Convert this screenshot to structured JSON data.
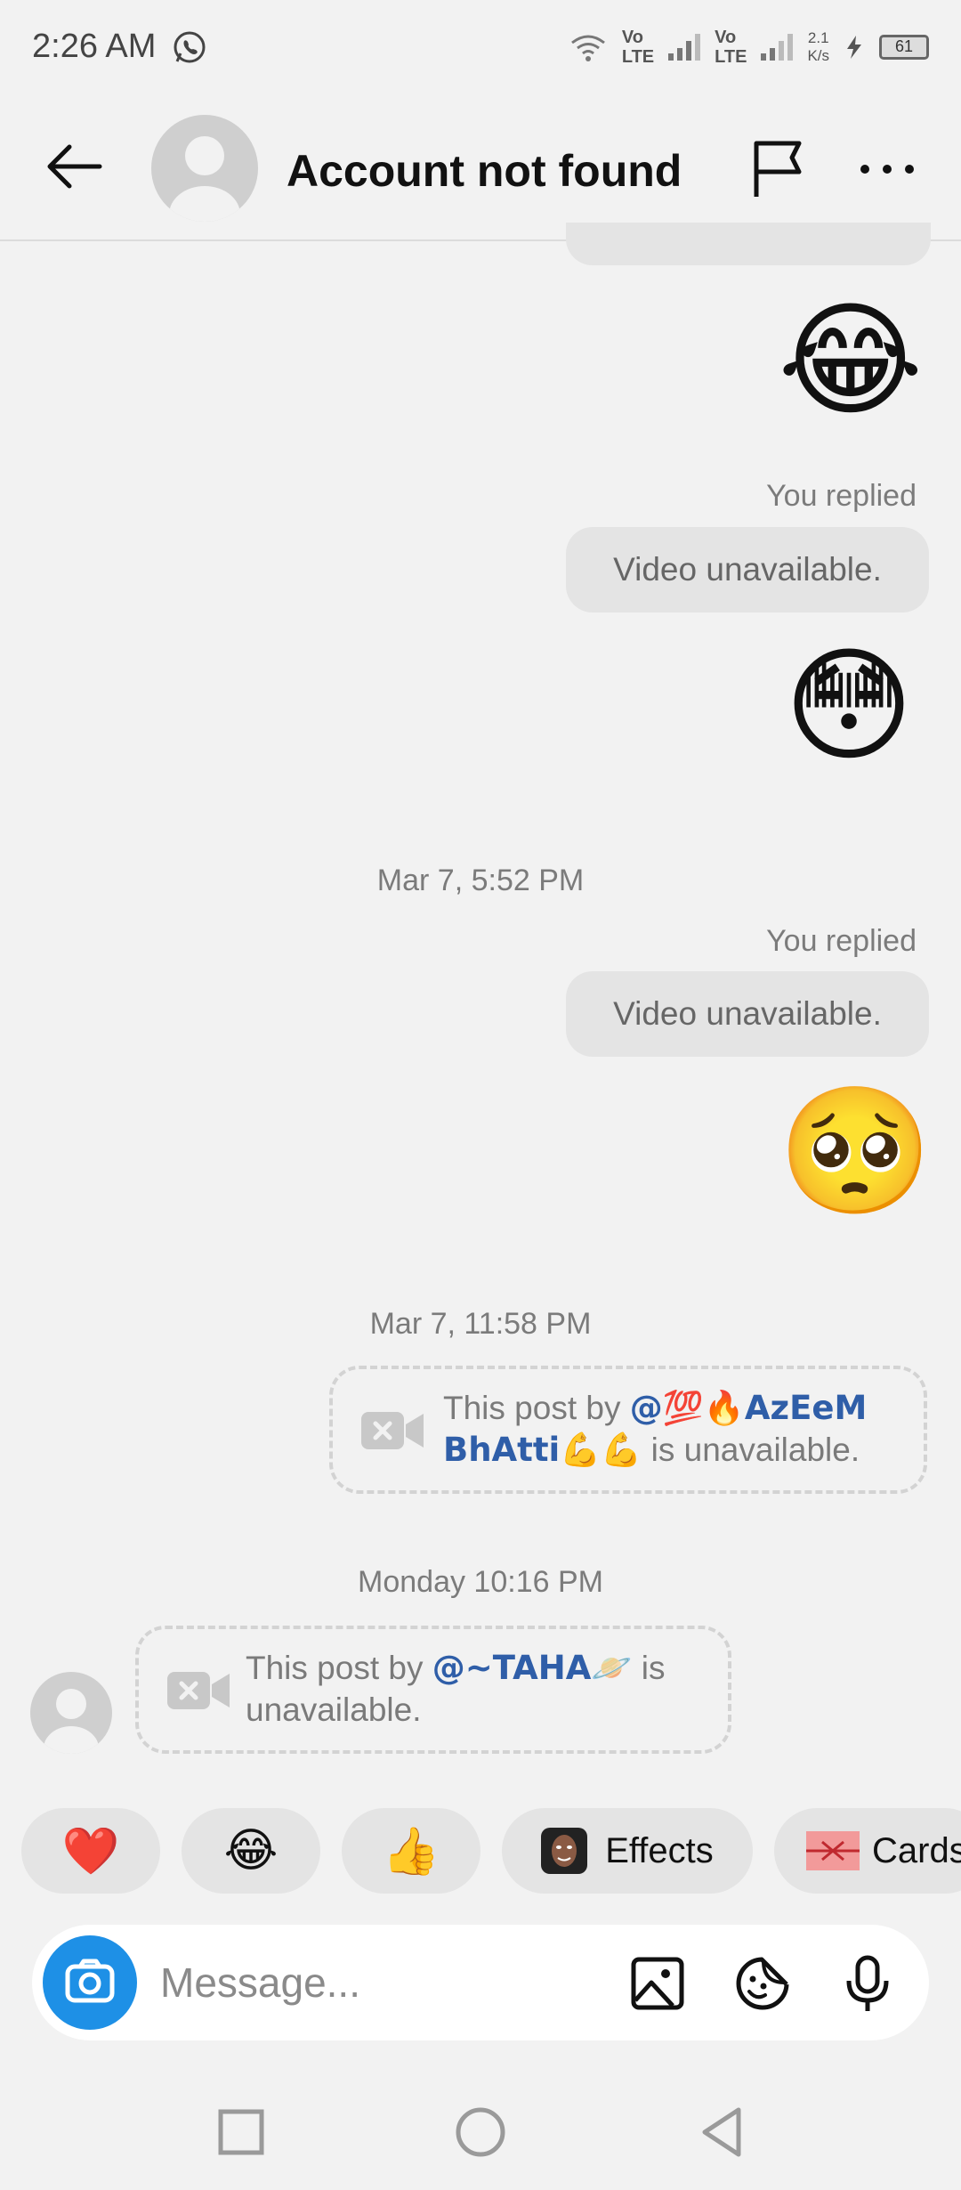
{
  "status_bar": {
    "time": "2:26 AM",
    "app_icon": "whatsapp-icon",
    "lte1_top": "Vo",
    "lte1_bottom": "LTE",
    "lte2_top": "Vo",
    "lte2_bottom": "LTE",
    "speed_value": "2.1",
    "speed_unit": "K/s",
    "battery": "61"
  },
  "header": {
    "title": "Account not found"
  },
  "messages": {
    "emoji_1": "😂",
    "replied_1": "You replied",
    "bubble_1": "Video unavailable.",
    "emoji_2": "😳",
    "timestamp_1": "Mar 7, 5:52 PM",
    "replied_2": "You replied",
    "bubble_2": "Video unavailable.",
    "emoji_3": "🥺",
    "timestamp_2": "Mar 7, 11:58 PM",
    "post_1": {
      "prefix": "This post by ",
      "mention_line1": "@💯🔥AzEeM",
      "mention_line2": "BhAtti💪💪",
      "suffix": " is unavailable."
    },
    "timestamp_3": "Monday 10:16 PM",
    "post_2": {
      "prefix": "This post by ",
      "mention": "@~TAHA🪐",
      "suffix": " is",
      "line2": "unavailable."
    }
  },
  "quick_reactions": [
    {
      "label": "❤️"
    },
    {
      "label": "😂"
    },
    {
      "label": "👍"
    },
    {
      "label": "Effects"
    },
    {
      "label": "Cards"
    }
  ],
  "composer": {
    "placeholder": "Message..."
  },
  "colors": {
    "background": "#f2f2f2",
    "bubble": "#e4e4e4",
    "mention": "#2f5ea8",
    "camera_button": "#1e90e6"
  }
}
